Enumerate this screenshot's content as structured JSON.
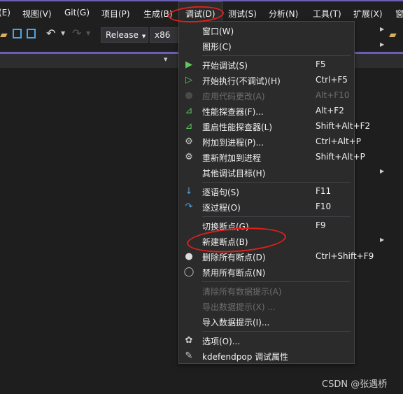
{
  "menubar": [
    "(E)",
    "视图(V)",
    "Git(G)",
    "项目(P)",
    "生成(B)",
    "调试(D)",
    "测试(S)",
    "分析(N)",
    "工具(T)",
    "扩展(X)",
    "窗"
  ],
  "toolbar": {
    "config": "Release",
    "platform": "x86"
  },
  "menu": {
    "groups": [
      [
        {
          "label": "窗口(W)",
          "submenu": true
        },
        {
          "label": "图形(C)",
          "submenu": true
        }
      ],
      [
        {
          "label": "开始调试(S)",
          "shortcut": "F5",
          "icon": "play-icon"
        },
        {
          "label": "开始执行(不调试)(H)",
          "shortcut": "Ctrl+F5",
          "icon": "play-outline-icon"
        },
        {
          "label": "应用代码更改(A)",
          "shortcut": "Alt+F10",
          "icon": "flame-icon",
          "disabled": true
        },
        {
          "label": "性能探查器(F)...",
          "shortcut": "Alt+F2",
          "icon": "performance-icon"
        },
        {
          "label": "重启性能探查器(L)",
          "shortcut": "Shift+Alt+F2",
          "icon": "performance-icon"
        },
        {
          "label": "附加到进程(P)...",
          "shortcut": "Ctrl+Alt+P",
          "icon": "gears-icon"
        },
        {
          "label": "重新附加到进程",
          "shortcut": "Shift+Alt+P",
          "icon": "gears-icon"
        },
        {
          "label": "其他调试目标(H)",
          "submenu": true
        }
      ],
      [
        {
          "label": "逐语句(S)",
          "shortcut": "F11",
          "icon": "step-into-icon"
        },
        {
          "label": "逐过程(O)",
          "shortcut": "F10",
          "icon": "step-over-icon"
        }
      ],
      [
        {
          "label": "切换断点(G)",
          "shortcut": "F9"
        },
        {
          "label": "新建断点(B)",
          "submenu": true
        },
        {
          "label": "删除所有断点(D)",
          "shortcut": "Ctrl+Shift+F9",
          "icon": "delete-breakpoints-icon"
        },
        {
          "label": "禁用所有断点(N)",
          "icon": "disable-breakpoints-icon"
        }
      ],
      [
        {
          "label": "清除所有数据提示(A)",
          "disabled": true
        },
        {
          "label": "导出数据提示(X) ...",
          "disabled": true
        },
        {
          "label": "导入数据提示(I)..."
        }
      ],
      [
        {
          "label": "选项(O)...",
          "icon": "gear-icon"
        },
        {
          "label": "kdefendpop 调试属性",
          "icon": "wrench-icon"
        }
      ]
    ]
  },
  "watermark": "CSDN @张遇桥",
  "colors": {
    "accent": "#6b5fb5",
    "highlight": "#e0201b",
    "play": "#5fc95f",
    "step": "#4fa3e0"
  }
}
